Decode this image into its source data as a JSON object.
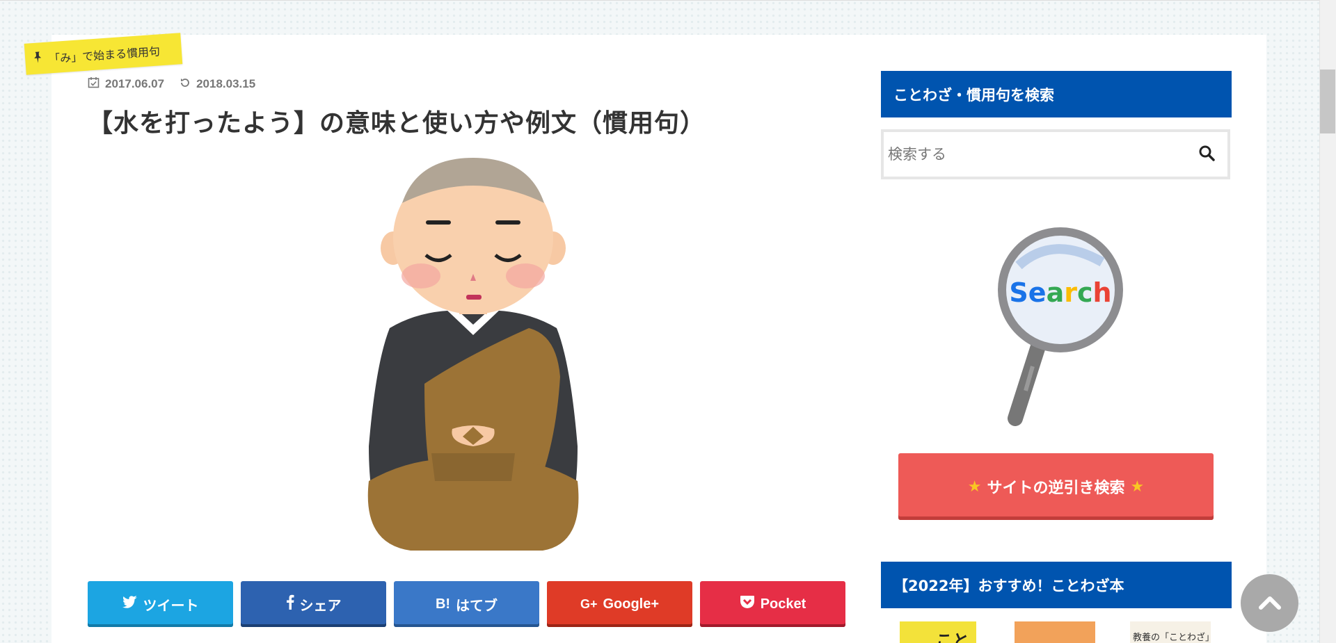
{
  "category": {
    "label": "「み」で始まる慣用句",
    "icon": "pushpin-icon"
  },
  "article": {
    "published": "2017.06.07",
    "updated": "2018.03.15",
    "title": "【水を打ったよう】の意味と使い方や例文（慣用句）",
    "image": "meditating-monk-illustration"
  },
  "share_buttons": [
    {
      "label": "ツイート",
      "icon": "twitter-bird-icon",
      "color": "#1ca5e2"
    },
    {
      "label": "シェア",
      "icon": "facebook-f-icon",
      "color": "#2d62b0"
    },
    {
      "label": "はてブ",
      "icon_text": "B!",
      "color": "#3a78c8"
    },
    {
      "label": "Google+",
      "icon_text": "G+",
      "color": "#df3b27"
    },
    {
      "label": "Pocket",
      "icon": "pocket-icon",
      "color": "#e62e46"
    }
  ],
  "sidebar": {
    "search_widget_title": "ことわざ・慣用句を検索",
    "search_placeholder": "検索する",
    "search_graphic_text": "Search",
    "reverse_search_label": "サイトの逆引き検索",
    "recommend_title": "【2022年】おすすめ！ことわざ本",
    "book_cover_texts": [
      "こと",
      "教養の「ことわざ」"
    ]
  },
  "colors": {
    "widget_blue": "#0054af",
    "reverse_btn": "#ee5a57",
    "category_tag": "#f7e634"
  }
}
